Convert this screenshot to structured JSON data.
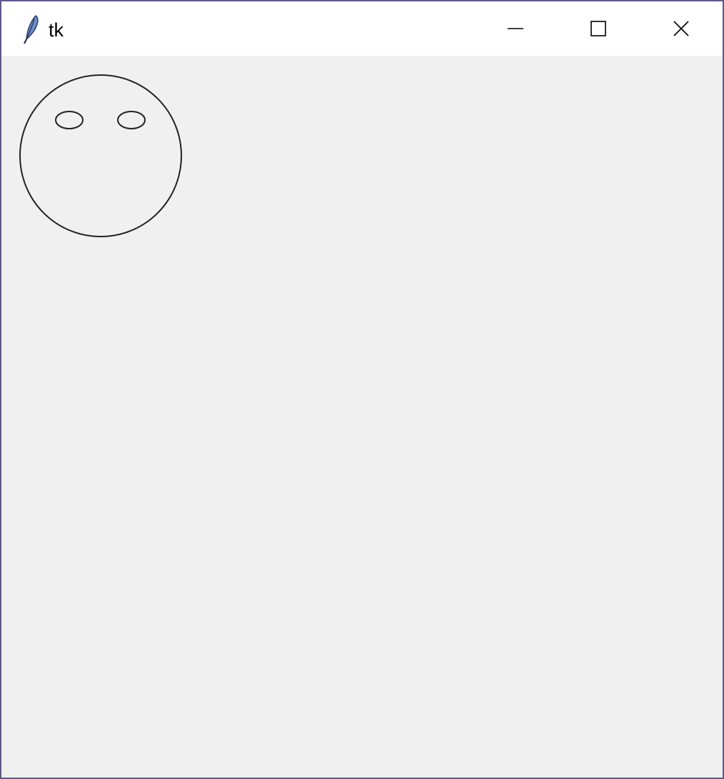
{
  "window": {
    "title": "tk",
    "controls": {
      "minimize_icon": "minimize-icon",
      "maximize_icon": "maximize-icon",
      "close_icon": "close-icon"
    },
    "app_icon": "tk-feather-icon",
    "border_color": "#5e5a8a",
    "titlebar_color": "#ffffff",
    "canvas_background": "#f0f0f0"
  },
  "canvas": {
    "drawing": "face",
    "stroke_color": "#222222"
  }
}
